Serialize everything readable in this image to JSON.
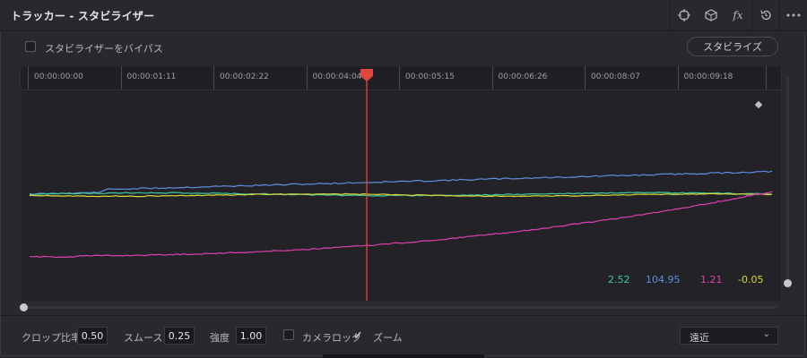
{
  "header": {
    "title": "トラッカー - スタビライザー",
    "icons": [
      "crosshair-icon",
      "cube-icon",
      "fx-icon",
      "reset-icon",
      "more-icon"
    ],
    "fx_label": "fx"
  },
  "bypass": {
    "label": "スタビライザーをバイパス",
    "checked": false
  },
  "stabilize_button": "スタビライズ",
  "timeline": {
    "timecodes": [
      "00:00:00:00",
      "00:00:01:11",
      "00:00:02:22",
      "00:00:04:04",
      "00:00:05:15",
      "00:00:06:26",
      "00:00:08:07",
      "00:00:09:18"
    ],
    "playhead_color": "#e0483f"
  },
  "curves": [
    {
      "name": "green",
      "color": "#3fc9a0",
      "value": "2.52"
    },
    {
      "name": "blue",
      "color": "#5f8fe0",
      "value": "104.95"
    },
    {
      "name": "magenta",
      "color": "#e040b0",
      "value": "1.21"
    },
    {
      "name": "yellow",
      "color": "#d9d93a",
      "value": "-0.05"
    }
  ],
  "footer": {
    "crop_ratio_label": "クロップ比率",
    "crop_ratio_value": "0.50",
    "smooth_label": "スムース",
    "smooth_value": "0.25",
    "strength_label": "強度",
    "strength_value": "1.00",
    "camera_lock_label": "カメラロック",
    "camera_lock_checked": false,
    "zoom_label": "ズーム",
    "zoom_checked": true,
    "mode_select": "遠近"
  }
}
